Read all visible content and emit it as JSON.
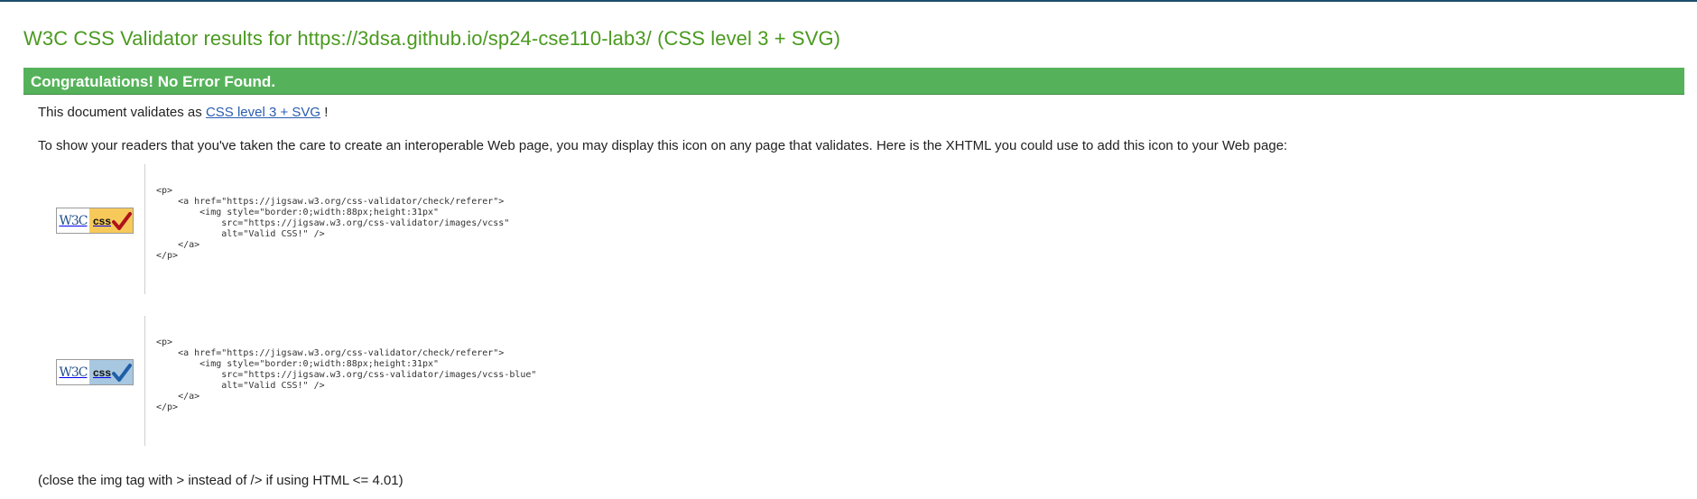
{
  "title": "W3C CSS Validator results for https://3dsa.github.io/sp24-cse110-lab3/ (CSS level 3 + SVG)",
  "congrats": "Congratulations! No Error Found.",
  "validates": {
    "prefix": "This document validates as ",
    "link_text": "CSS level 3 + SVG",
    "suffix": " !"
  },
  "info": "To show your readers that you've taken the care to create an interoperable Web page, you may display this icon on any page that validates. Here is the XHTML you could use to add this icon to your Web page:",
  "badges": [
    {
      "w3c_text": "W3C",
      "css_text": "css",
      "variant": "gold",
      "check_color": "#b0121b",
      "code": "<p>\n    <a href=\"https://jigsaw.w3.org/css-validator/check/referer\">\n        <img style=\"border:0;width:88px;height:31px\"\n            src=\"https://jigsaw.w3.org/css-validator/images/vcss\"\n            alt=\"Valid CSS!\" />\n    </a>\n</p>"
    },
    {
      "w3c_text": "W3C",
      "css_text": "css",
      "variant": "blue",
      "check_color": "#1f5fa8",
      "code": "<p>\n    <a href=\"https://jigsaw.w3.org/css-validator/check/referer\">\n        <img style=\"border:0;width:88px;height:31px\"\n            src=\"https://jigsaw.w3.org/css-validator/images/vcss-blue\"\n            alt=\"Valid CSS!\" />\n    </a>\n</p>"
    }
  ],
  "footnote": "(close the img tag with > instead of /> if using HTML <= 4.01)",
  "colors": {
    "title": "#4a9a1f",
    "congrats_bg": "#55b25a",
    "link": "#2a5db0",
    "top_rule": "#1d4e6b"
  }
}
